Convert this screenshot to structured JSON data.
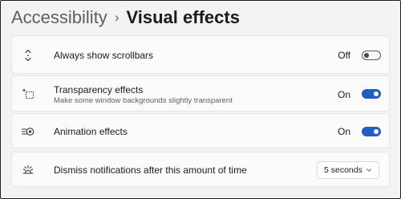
{
  "breadcrumb": {
    "parent": "Accessibility",
    "separator": "›",
    "current": "Visual effects"
  },
  "settings": [
    {
      "id": "scrollbars",
      "icon": "scrollbar-arrows-icon",
      "title": "Always show scrollbars",
      "state_label": "Off",
      "enabled": false
    },
    {
      "id": "transparency",
      "icon": "transparency-icon",
      "title": "Transparency effects",
      "description": "Make some window backgrounds slightly transparent",
      "state_label": "On",
      "enabled": true
    },
    {
      "id": "animation",
      "icon": "animation-icon",
      "title": "Animation effects",
      "state_label": "On",
      "enabled": true
    },
    {
      "id": "notifications",
      "icon": "brightness-icon",
      "title": "Dismiss notifications after this amount of time",
      "dropdown_value": "5 seconds"
    }
  ],
  "colors": {
    "accent": "#1f5fc4",
    "background": "#f3f3f3",
    "card": "#fbfbfb"
  }
}
